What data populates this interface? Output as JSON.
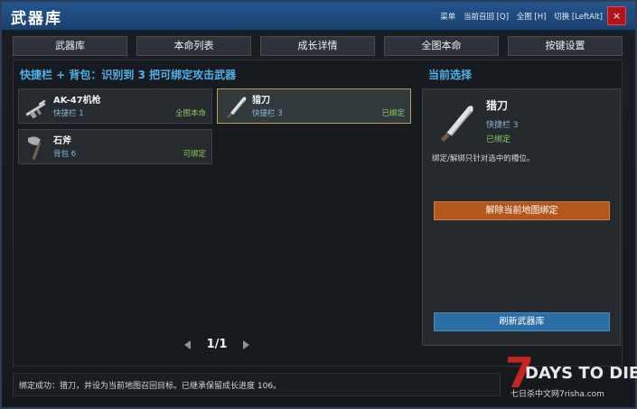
{
  "window": {
    "title": "武器库",
    "hotkeys": [
      "菜单",
      "当前召回 [Q]",
      "全图 [H]",
      "切换 [LeftAlt]"
    ],
    "close_label": "×"
  },
  "tabs": [
    {
      "label": "武器库"
    },
    {
      "label": "本命列表"
    },
    {
      "label": "成长详情"
    },
    {
      "label": "全图本命"
    },
    {
      "label": "按键设置"
    }
  ],
  "list": {
    "title": "快捷栏 + 背包：识别到 3 把可绑定攻击武器",
    "items": [
      {
        "name": "AK-47机枪",
        "slot": "快捷栏 1",
        "status": "全图本命",
        "icon": "rifle-icon"
      },
      {
        "name": "猎刀",
        "slot": "快捷栏 3",
        "status": "已绑定",
        "icon": "hunting-knife-icon"
      },
      {
        "name": "石斧",
        "slot": "背包 6",
        "status": "可绑定",
        "icon": "stone-axe-icon"
      }
    ]
  },
  "detail": {
    "section_title": "当前选择",
    "name": "猎刀",
    "slot": "快捷栏 3",
    "status": "已绑定",
    "note": "绑定/解绑只针对选中的槽位。",
    "unbind_label": "解除当前地图绑定",
    "refresh_label": "刷新武器库"
  },
  "pager": {
    "page": "1/1"
  },
  "status_message": "绑定成功：猎刀，并设为当前地图召回目标。已继承保留成长进度 106。",
  "logo": {
    "title": "7DAYS TO DIE",
    "subtitle": "七日杀中文网7risha.com"
  },
  "colors": {
    "accent_blue": "#4fb0e8",
    "bound_green": "#8ec95a",
    "unbind_orange": "#b2581f",
    "refresh_blue": "#2b6ea6",
    "close_red": "#b3131a"
  }
}
